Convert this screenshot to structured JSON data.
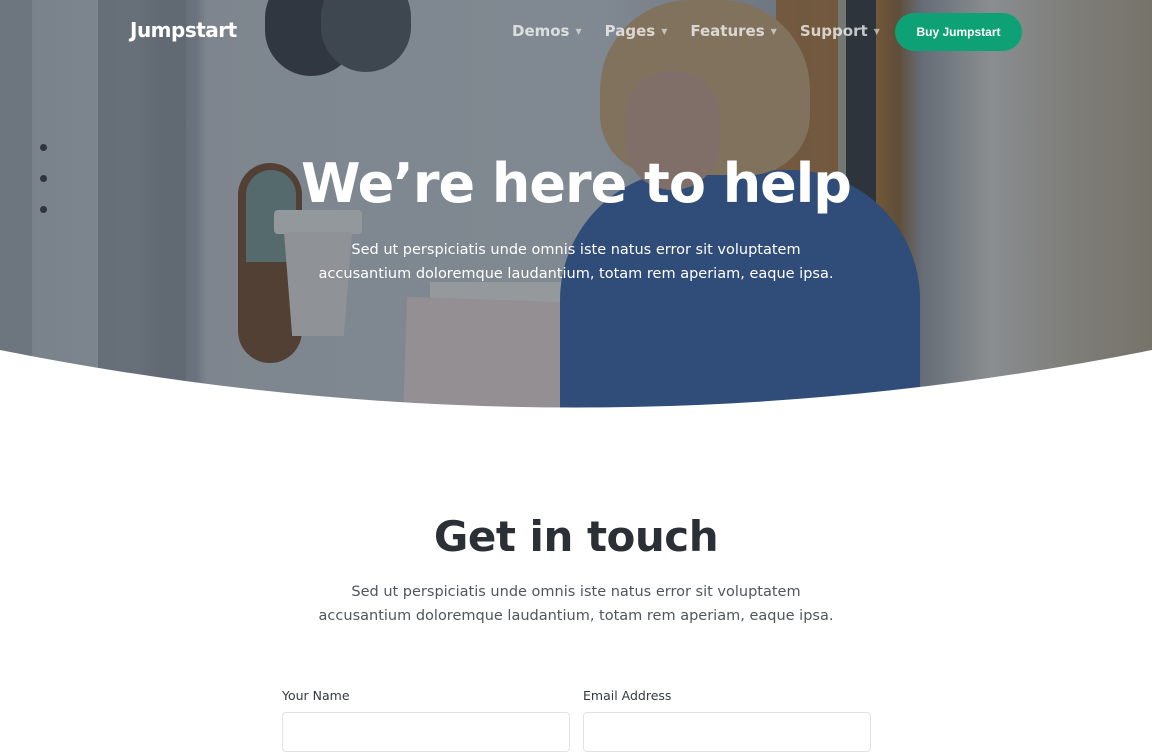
{
  "nav": {
    "brand": "Jumpstart",
    "items": [
      {
        "label": "Demos"
      },
      {
        "label": "Pages"
      },
      {
        "label": "Features"
      },
      {
        "label": "Support"
      }
    ],
    "cta_label": "Buy Jumpstart"
  },
  "hero": {
    "title": "We’re here to help",
    "text_line1": "Sed ut perspiciatis unde omnis iste natus error sit voluptatem",
    "text_line2": "accusantium doloremque laudantium, totam rem aperiam, eaque ipsa."
  },
  "contact": {
    "title": "Get in touch",
    "text_line1": "Sed ut perspiciatis unde omnis iste natus error sit voluptatem",
    "text_line2": "accusantium doloremque laudantium, totam rem aperiam, eaque ipsa.",
    "name_label": "Your Name",
    "email_label": "Email Address",
    "name_value": "",
    "email_value": ""
  },
  "colors": {
    "accent": "#0ea175",
    "heading": "#2b3036",
    "body_text": "#4f565e"
  }
}
